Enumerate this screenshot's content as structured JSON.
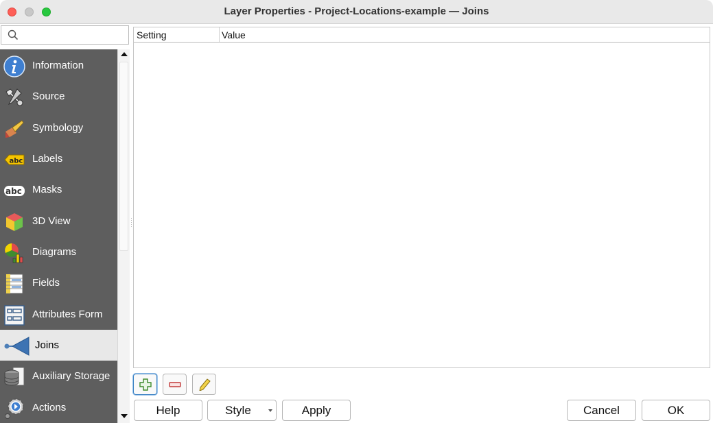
{
  "window": {
    "title": "Layer Properties - Project-Locations-example — Joins"
  },
  "search": {
    "placeholder": "",
    "value": ""
  },
  "sidebar": {
    "items": [
      {
        "label": "Information",
        "icon": "information-icon"
      },
      {
        "label": "Source",
        "icon": "source-icon"
      },
      {
        "label": "Symbology",
        "icon": "symbology-icon"
      },
      {
        "label": "Labels",
        "icon": "labels-icon"
      },
      {
        "label": "Masks",
        "icon": "masks-icon"
      },
      {
        "label": "3D View",
        "icon": "3d-view-icon"
      },
      {
        "label": "Diagrams",
        "icon": "diagrams-icon"
      },
      {
        "label": "Fields",
        "icon": "fields-icon"
      },
      {
        "label": "Attributes Form",
        "icon": "attributes-form-icon"
      },
      {
        "label": "Joins",
        "icon": "joins-icon",
        "active": true
      },
      {
        "label": "Auxiliary Storage",
        "icon": "auxiliary-storage-icon"
      },
      {
        "label": "Actions",
        "icon": "actions-icon"
      }
    ]
  },
  "table": {
    "columns": [
      "Setting",
      "Value"
    ],
    "rows": []
  },
  "tools": {
    "add": "add-join-icon",
    "remove": "remove-join-icon",
    "edit": "edit-join-icon"
  },
  "buttons": {
    "help": "Help",
    "style": "Style",
    "apply": "Apply",
    "cancel": "Cancel",
    "ok": "OK"
  },
  "colors": {
    "sidebar_bg": "#5e5e5e",
    "active_item_bg": "#e8e8e8",
    "accent": "#3b82c4"
  }
}
